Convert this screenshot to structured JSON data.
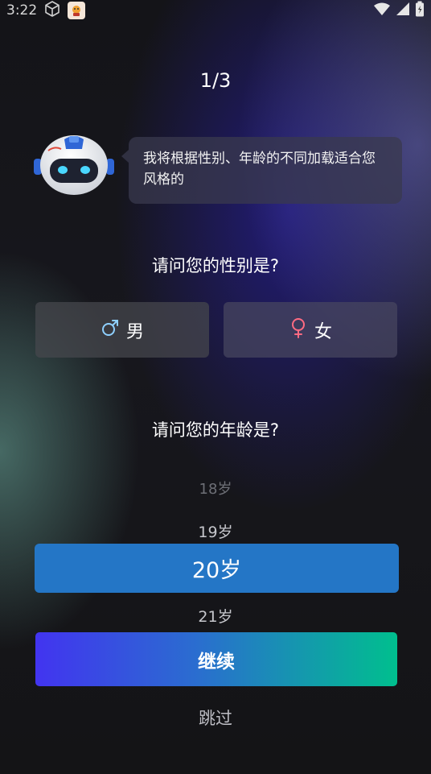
{
  "status_bar": {
    "time": "3:22"
  },
  "progress": "1/3",
  "assistant": {
    "message": "我将根据性别、年龄的不同加载适合您风格的"
  },
  "gender": {
    "question": "请问您的性别是?",
    "options": [
      {
        "label": "男",
        "icon": "male-icon",
        "icon_color": "#8fd0ff"
      },
      {
        "label": "女",
        "icon": "female-icon",
        "icon_color": "#ff6b82"
      }
    ]
  },
  "age": {
    "question": "请问您的年龄是?",
    "options": [
      "18岁",
      "19岁",
      "20岁",
      "21岁"
    ],
    "selected": "20岁"
  },
  "actions": {
    "continue_label": "继续",
    "skip_label": "跳过"
  },
  "colors": {
    "selected_age_bg": "#2476c6",
    "continue_gradient_start": "#4234f0",
    "continue_gradient_end": "#00bf8e"
  }
}
